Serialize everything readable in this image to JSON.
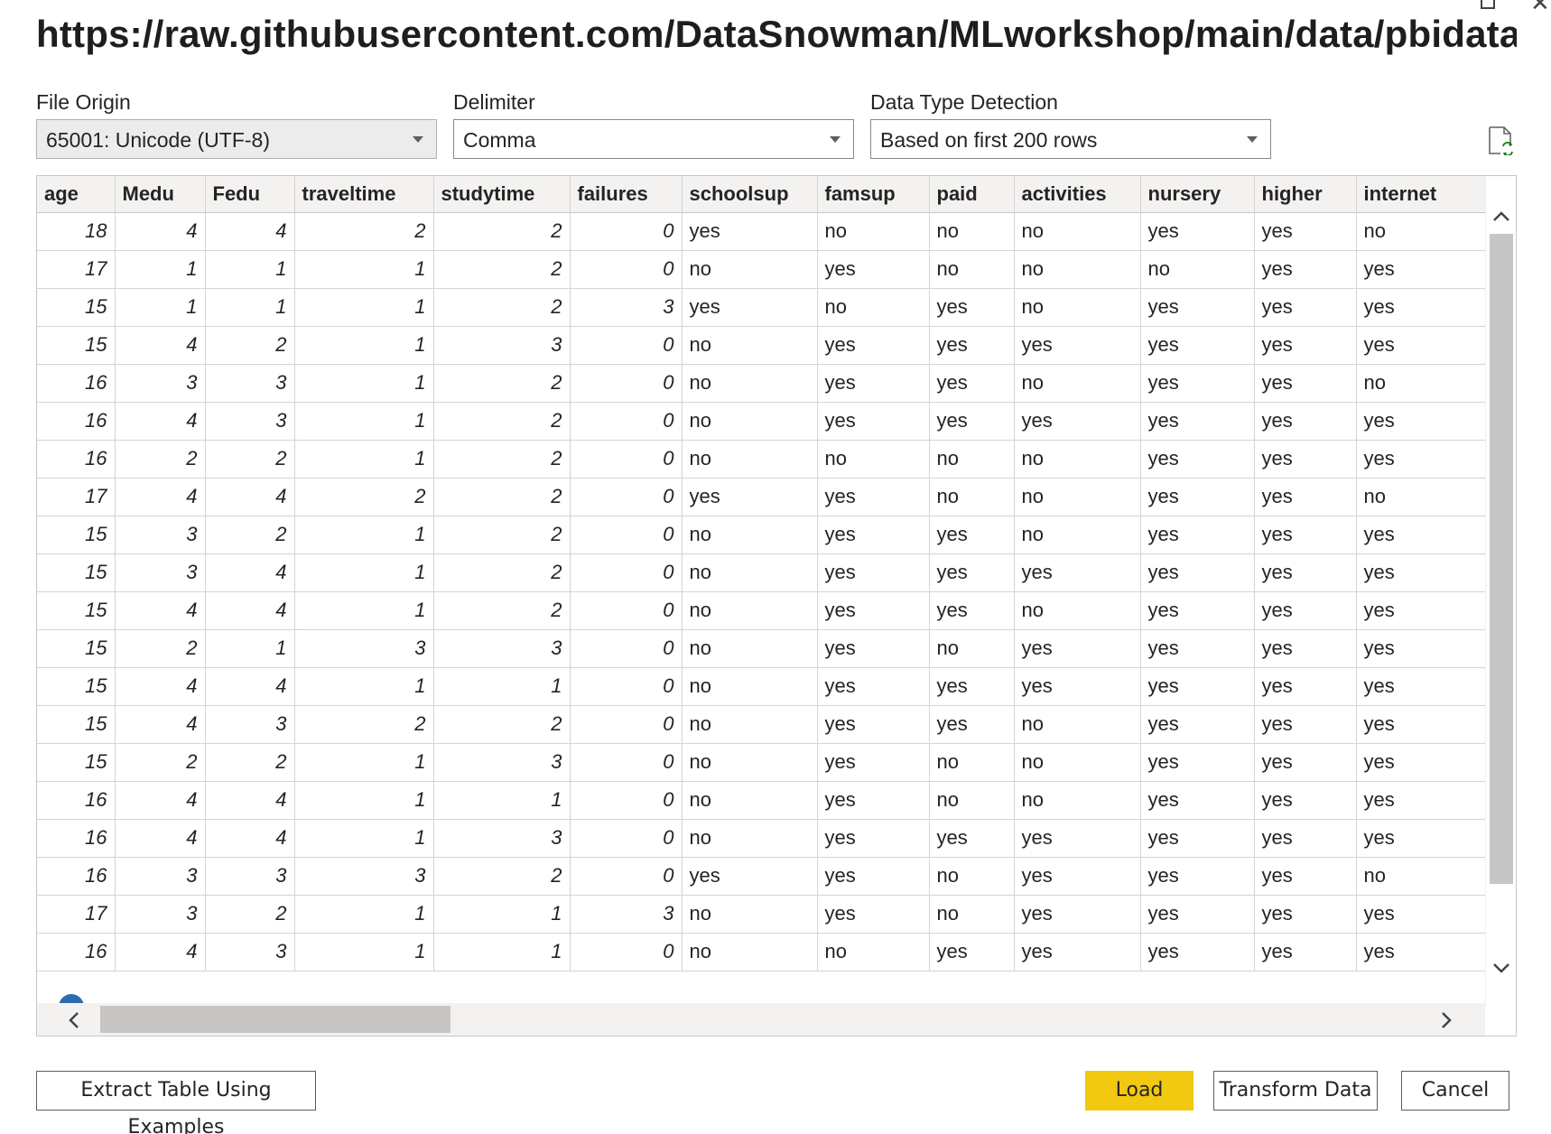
{
  "title": "https://raw.githubusercontent.com/DataSnowman/MLworkshop/main/data/pbidata/stu...",
  "options": {
    "file_origin": {
      "label": "File Origin",
      "value": "65001: Unicode (UTF-8)"
    },
    "delimiter": {
      "label": "Delimiter",
      "value": "Comma"
    },
    "data_type_detection": {
      "label": "Data Type Detection",
      "value": "Based on first 200 rows"
    }
  },
  "grid": {
    "columns": [
      "age",
      "Medu",
      "Fedu",
      "traveltime",
      "studytime",
      "failures",
      "schoolsup",
      "famsup",
      "paid",
      "activities",
      "nursery",
      "higher",
      "internet"
    ],
    "rows": [
      [
        "18",
        "4",
        "4",
        "2",
        "2",
        "0",
        "yes",
        "no",
        "no",
        "no",
        "yes",
        "yes",
        "no"
      ],
      [
        "17",
        "1",
        "1",
        "1",
        "2",
        "0",
        "no",
        "yes",
        "no",
        "no",
        "no",
        "yes",
        "yes"
      ],
      [
        "15",
        "1",
        "1",
        "1",
        "2",
        "3",
        "yes",
        "no",
        "yes",
        "no",
        "yes",
        "yes",
        "yes"
      ],
      [
        "15",
        "4",
        "2",
        "1",
        "3",
        "0",
        "no",
        "yes",
        "yes",
        "yes",
        "yes",
        "yes",
        "yes"
      ],
      [
        "16",
        "3",
        "3",
        "1",
        "2",
        "0",
        "no",
        "yes",
        "yes",
        "no",
        "yes",
        "yes",
        "no"
      ],
      [
        "16",
        "4",
        "3",
        "1",
        "2",
        "0",
        "no",
        "yes",
        "yes",
        "yes",
        "yes",
        "yes",
        "yes"
      ],
      [
        "16",
        "2",
        "2",
        "1",
        "2",
        "0",
        "no",
        "no",
        "no",
        "no",
        "yes",
        "yes",
        "yes"
      ],
      [
        "17",
        "4",
        "4",
        "2",
        "2",
        "0",
        "yes",
        "yes",
        "no",
        "no",
        "yes",
        "yes",
        "no"
      ],
      [
        "15",
        "3",
        "2",
        "1",
        "2",
        "0",
        "no",
        "yes",
        "yes",
        "no",
        "yes",
        "yes",
        "yes"
      ],
      [
        "15",
        "3",
        "4",
        "1",
        "2",
        "0",
        "no",
        "yes",
        "yes",
        "yes",
        "yes",
        "yes",
        "yes"
      ],
      [
        "15",
        "4",
        "4",
        "1",
        "2",
        "0",
        "no",
        "yes",
        "yes",
        "no",
        "yes",
        "yes",
        "yes"
      ],
      [
        "15",
        "2",
        "1",
        "3",
        "3",
        "0",
        "no",
        "yes",
        "no",
        "yes",
        "yes",
        "yes",
        "yes"
      ],
      [
        "15",
        "4",
        "4",
        "1",
        "1",
        "0",
        "no",
        "yes",
        "yes",
        "yes",
        "yes",
        "yes",
        "yes"
      ],
      [
        "15",
        "4",
        "3",
        "2",
        "2",
        "0",
        "no",
        "yes",
        "yes",
        "no",
        "yes",
        "yes",
        "yes"
      ],
      [
        "15",
        "2",
        "2",
        "1",
        "3",
        "0",
        "no",
        "yes",
        "no",
        "no",
        "yes",
        "yes",
        "yes"
      ],
      [
        "16",
        "4",
        "4",
        "1",
        "1",
        "0",
        "no",
        "yes",
        "no",
        "no",
        "yes",
        "yes",
        "yes"
      ],
      [
        "16",
        "4",
        "4",
        "1",
        "3",
        "0",
        "no",
        "yes",
        "yes",
        "yes",
        "yes",
        "yes",
        "yes"
      ],
      [
        "16",
        "3",
        "3",
        "3",
        "2",
        "0",
        "yes",
        "yes",
        "no",
        "yes",
        "yes",
        "yes",
        "no"
      ],
      [
        "17",
        "3",
        "2",
        "1",
        "1",
        "3",
        "no",
        "yes",
        "no",
        "yes",
        "yes",
        "yes",
        "yes"
      ],
      [
        "16",
        "4",
        "3",
        "1",
        "1",
        "0",
        "no",
        "no",
        "yes",
        "yes",
        "yes",
        "yes",
        "yes"
      ]
    ]
  },
  "buttons": {
    "extract": "Extract Table Using Examples",
    "load": "Load",
    "transform": "Transform Data",
    "cancel": "Cancel"
  },
  "colors": {
    "primary_button": "#F2C811",
    "header_bg": "#F3F2F1",
    "scrollbar": "#C8C6C4"
  },
  "icons": {
    "refresh": "refresh-file-icon",
    "info": "info-icon"
  }
}
